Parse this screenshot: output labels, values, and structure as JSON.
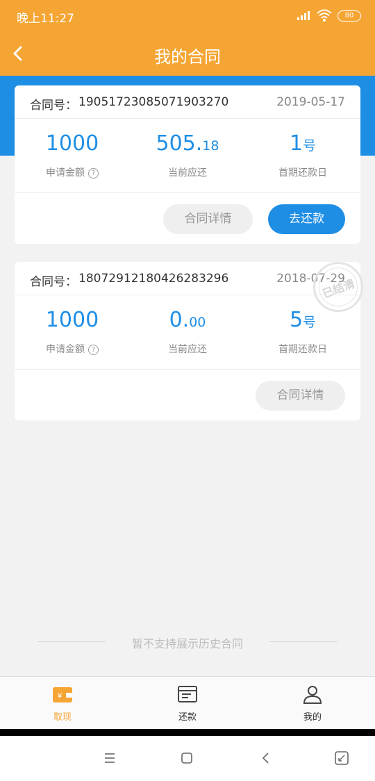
{
  "status": {
    "time": "晚上11:27",
    "battery": "80"
  },
  "nav": {
    "title": "我的合同"
  },
  "contracts": [
    {
      "label": "合同号：",
      "number": "19051723085071903270",
      "date": "2019-05-17",
      "amount": "1000",
      "amount_label": "申请金额",
      "due_int": "505.",
      "due_dec": "18",
      "due_label": "当前应还",
      "first_day": "1",
      "first_day_unit": "号",
      "first_day_label": "首期还款日",
      "detail_btn": "合同详情",
      "repay_btn": "去还款"
    },
    {
      "label": "合同号：",
      "number": "18072912180426283296",
      "date": "2018-07-29",
      "amount": "1000",
      "amount_label": "申请金额",
      "due_int": "0.",
      "due_dec": "00",
      "due_label": "当前应还",
      "first_day": "5",
      "first_day_unit": "号",
      "first_day_label": "首期还款日",
      "detail_btn": "合同详情",
      "stamp": "已结清"
    }
  ],
  "history_note": "暂不支持展示历史合同",
  "tabs": [
    {
      "label": "取现",
      "active": true,
      "icon": "wallet-icon"
    },
    {
      "label": "还款",
      "active": false,
      "icon": "bill-icon"
    },
    {
      "label": "我的",
      "active": false,
      "icon": "user-icon"
    }
  ],
  "colors": {
    "accent": "#f5a533",
    "blue": "#1e8ee5"
  }
}
